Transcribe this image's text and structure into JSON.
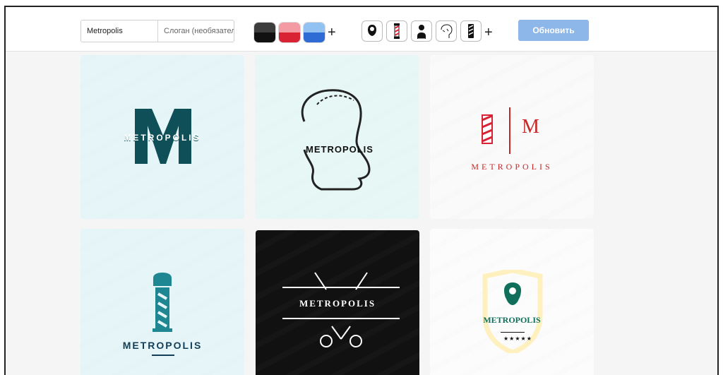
{
  "toolbar": {
    "name_value": "Metropolis",
    "slogan_placeholder": "Слоган (необязател",
    "update_label": "Обновить",
    "colors": [
      "black",
      "red",
      "blue"
    ],
    "icons": [
      "beard-man-icon",
      "barber-pole-icon",
      "bearded-bust-icon",
      "head-profile-icon",
      "barber-pole-alt-icon"
    ]
  },
  "logos": [
    {
      "text": "METROPOLIS",
      "style": "big-M"
    },
    {
      "text": "METROPOLIS",
      "style": "head-profile"
    },
    {
      "text": "METROPOLIS",
      "monogram": "M",
      "style": "barber-pole-monogram"
    },
    {
      "text": "METROPOLIS",
      "style": "barber-pole"
    },
    {
      "text": "METROPOLIS",
      "style": "scissors-dark"
    },
    {
      "text": "METROPOLIS",
      "style": "beard-shield"
    }
  ]
}
